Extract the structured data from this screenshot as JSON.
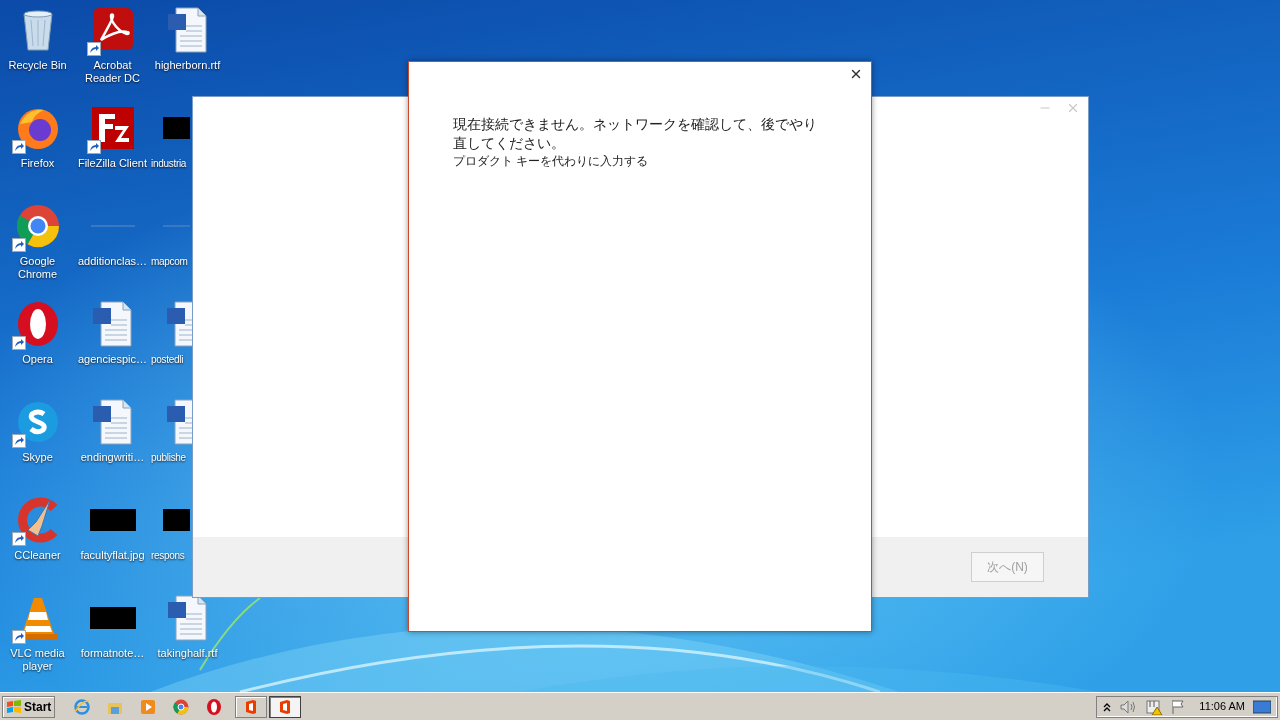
{
  "desktop_columns": [
    [
      {
        "label": "Recycle Bin",
        "kind": "recycle",
        "shortcut": false
      },
      {
        "label": "Firefox",
        "kind": "firefox",
        "shortcut": true
      },
      {
        "label": "Google Chrome",
        "kind": "chrome",
        "shortcut": true
      },
      {
        "label": "Opera",
        "kind": "opera",
        "shortcut": true
      },
      {
        "label": "Skype",
        "kind": "skype",
        "shortcut": true
      },
      {
        "label": "CCleaner",
        "kind": "ccleaner",
        "shortcut": true
      },
      {
        "label": "VLC media player",
        "kind": "vlc",
        "shortcut": true
      }
    ],
    [
      {
        "label": "Acrobat Reader DC",
        "kind": "acrobat",
        "shortcut": true
      },
      {
        "label": "FileZilla Client",
        "kind": "filezilla",
        "shortcut": true
      },
      {
        "label": "additionclas…",
        "kind": "blank",
        "shortcut": false
      },
      {
        "label": "agenciespic…",
        "kind": "word",
        "shortcut": false
      },
      {
        "label": "endingwriti…",
        "kind": "word",
        "shortcut": false
      },
      {
        "label": "facultyflat.jpg",
        "kind": "thumbnail",
        "shortcut": false
      },
      {
        "label": "formatnote…",
        "kind": "thumbnail",
        "shortcut": false
      }
    ],
    [
      {
        "label": "higherborn.rtf",
        "kind": "word",
        "shortcut": false
      },
      {
        "label": "industria",
        "kind": "thumbnail",
        "shortcut": false
      },
      {
        "label": "mapcom",
        "kind": "blank",
        "shortcut": false
      },
      {
        "label": "postedli",
        "kind": "word",
        "shortcut": false
      },
      {
        "label": "publishe",
        "kind": "word",
        "shortcut": false
      },
      {
        "label": "respons",
        "kind": "thumbnail",
        "shortcut": false
      },
      {
        "label": "takinghalf.rtf",
        "kind": "word",
        "shortcut": false
      }
    ]
  ],
  "installer_window": {
    "next_button": {
      "label": "次へ(N)",
      "disabled": true
    }
  },
  "dialog": {
    "message": "現在接続できません。ネットワークを確認して、後でやり直してください。",
    "link": "プロダクト キーを代わりに入力する"
  },
  "taskbar": {
    "start": "Start",
    "pinned": [
      {
        "kind": "ie"
      },
      {
        "kind": "explorer"
      },
      {
        "kind": "media"
      },
      {
        "kind": "chrome"
      },
      {
        "kind": "opera"
      }
    ],
    "tasks": [
      {
        "kind": "office",
        "selected": false
      },
      {
        "kind": "office",
        "selected": true
      }
    ],
    "clock": "11:06 AM"
  }
}
